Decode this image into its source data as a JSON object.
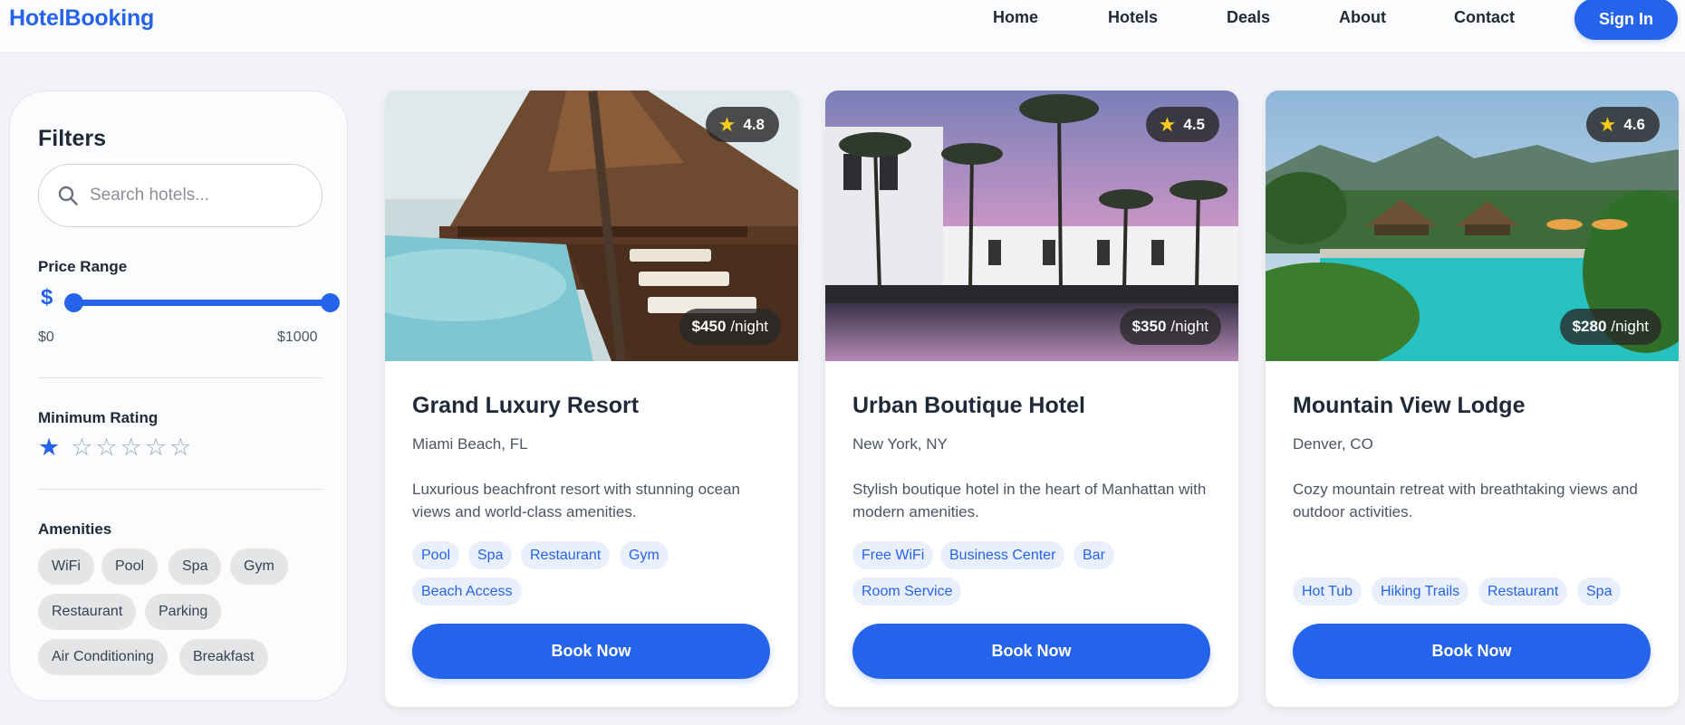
{
  "header": {
    "brand": "HotelBooking",
    "nav": [
      "Home",
      "Hotels",
      "Deals",
      "About",
      "Contact"
    ],
    "signin_label": "Sign In"
  },
  "filters": {
    "title": "Filters",
    "search_placeholder": "Search hotels...",
    "price_label": "Price Range",
    "price_icon": "$",
    "price_min": "$0",
    "price_max": "$1000",
    "rating_label": "Minimum Rating",
    "min_rating": 1,
    "rating_max": 6,
    "amenities_label": "Amenities",
    "amenities": [
      "WiFi",
      "Pool",
      "Spa",
      "Gym",
      "Restaurant",
      "Parking",
      "Air Conditioning",
      "Breakfast"
    ]
  },
  "hotels": [
    {
      "name": "Grand Luxury Resort",
      "location": "Miami Beach, FL",
      "description": "Luxurious beachfront resort with stunning ocean views and world-class amenities.",
      "rating": "4.8",
      "price": "$450",
      "per": "/night",
      "tags": [
        "Pool",
        "Spa",
        "Restaurant",
        "Gym",
        "Beach Access"
      ],
      "button": "Book Now"
    },
    {
      "name": "Urban Boutique Hotel",
      "location": "New York, NY",
      "description": "Stylish boutique hotel in the heart of Manhattan with modern amenities.",
      "rating": "4.5",
      "price": "$350",
      "per": "/night",
      "tags": [
        "Free WiFi",
        "Business Center",
        "Bar",
        "Room Service"
      ],
      "button": "Book Now"
    },
    {
      "name": "Mountain View Lodge",
      "location": "Denver, CO",
      "description": "Cozy mountain retreat with breathtaking views and outdoor activities.",
      "rating": "4.6",
      "price": "$280",
      "per": "/night",
      "tags": [
        "Hot Tub",
        "Hiking Trails",
        "Restaurant",
        "Spa"
      ],
      "button": "Book Now"
    }
  ],
  "colors": {
    "accent": "#2563eb",
    "star": "#facc15",
    "tag_bg": "#eaf0fb"
  }
}
